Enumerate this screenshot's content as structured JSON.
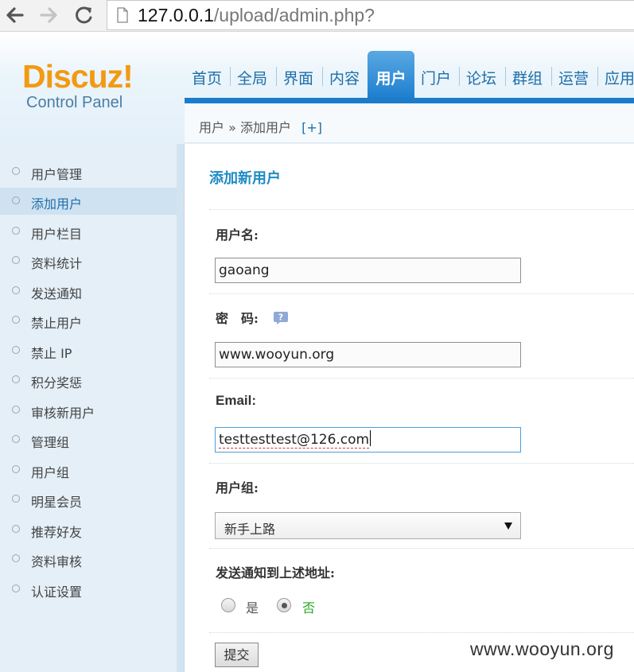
{
  "browser": {
    "url_host": "127.0.0.1",
    "url_path": "/upload/admin.php?"
  },
  "logo": {
    "brand": "Discuz!",
    "subtitle": "Control Panel"
  },
  "topnav": {
    "items": [
      "首页",
      "全局",
      "界面",
      "内容",
      "用户",
      "门户",
      "论坛",
      "群组",
      "运营",
      "应用"
    ],
    "active": "用户"
  },
  "breadcrumb": {
    "section": "用户",
    "separator": "»",
    "page": "添加用户",
    "add_link": "[+]"
  },
  "sidebar": {
    "items": [
      "用户管理",
      "添加用户",
      "用户栏目",
      "资料统计",
      "发送通知",
      "禁止用户",
      "禁止 IP",
      "积分奖惩",
      "审核新用户",
      "管理组",
      "用户组",
      "明星会员",
      "推荐好友",
      "资料审核",
      "认证设置"
    ],
    "active": "添加用户"
  },
  "form": {
    "title": "添加新用户",
    "username_label": "用户名:",
    "username_value": "gaoang",
    "password_label": "密　码:",
    "password_value": "www.wooyun.org",
    "email_label": "Email:",
    "email_value": "testtesttest@126.com",
    "usergroup_label": "用户组:",
    "usergroup_value": "新手上路",
    "notify_label": "发送通知到上述地址:",
    "notify_yes": "是",
    "notify_no": "否",
    "notify_selected": "否",
    "submit_label": "提交"
  },
  "watermark": "www.wooyun.org",
  "colors": {
    "accent": "#1c7cc9",
    "logo_orange": "#f19a12",
    "sidebar_bg": "#e4eff7",
    "title_blue": "#1e8ac4"
  }
}
